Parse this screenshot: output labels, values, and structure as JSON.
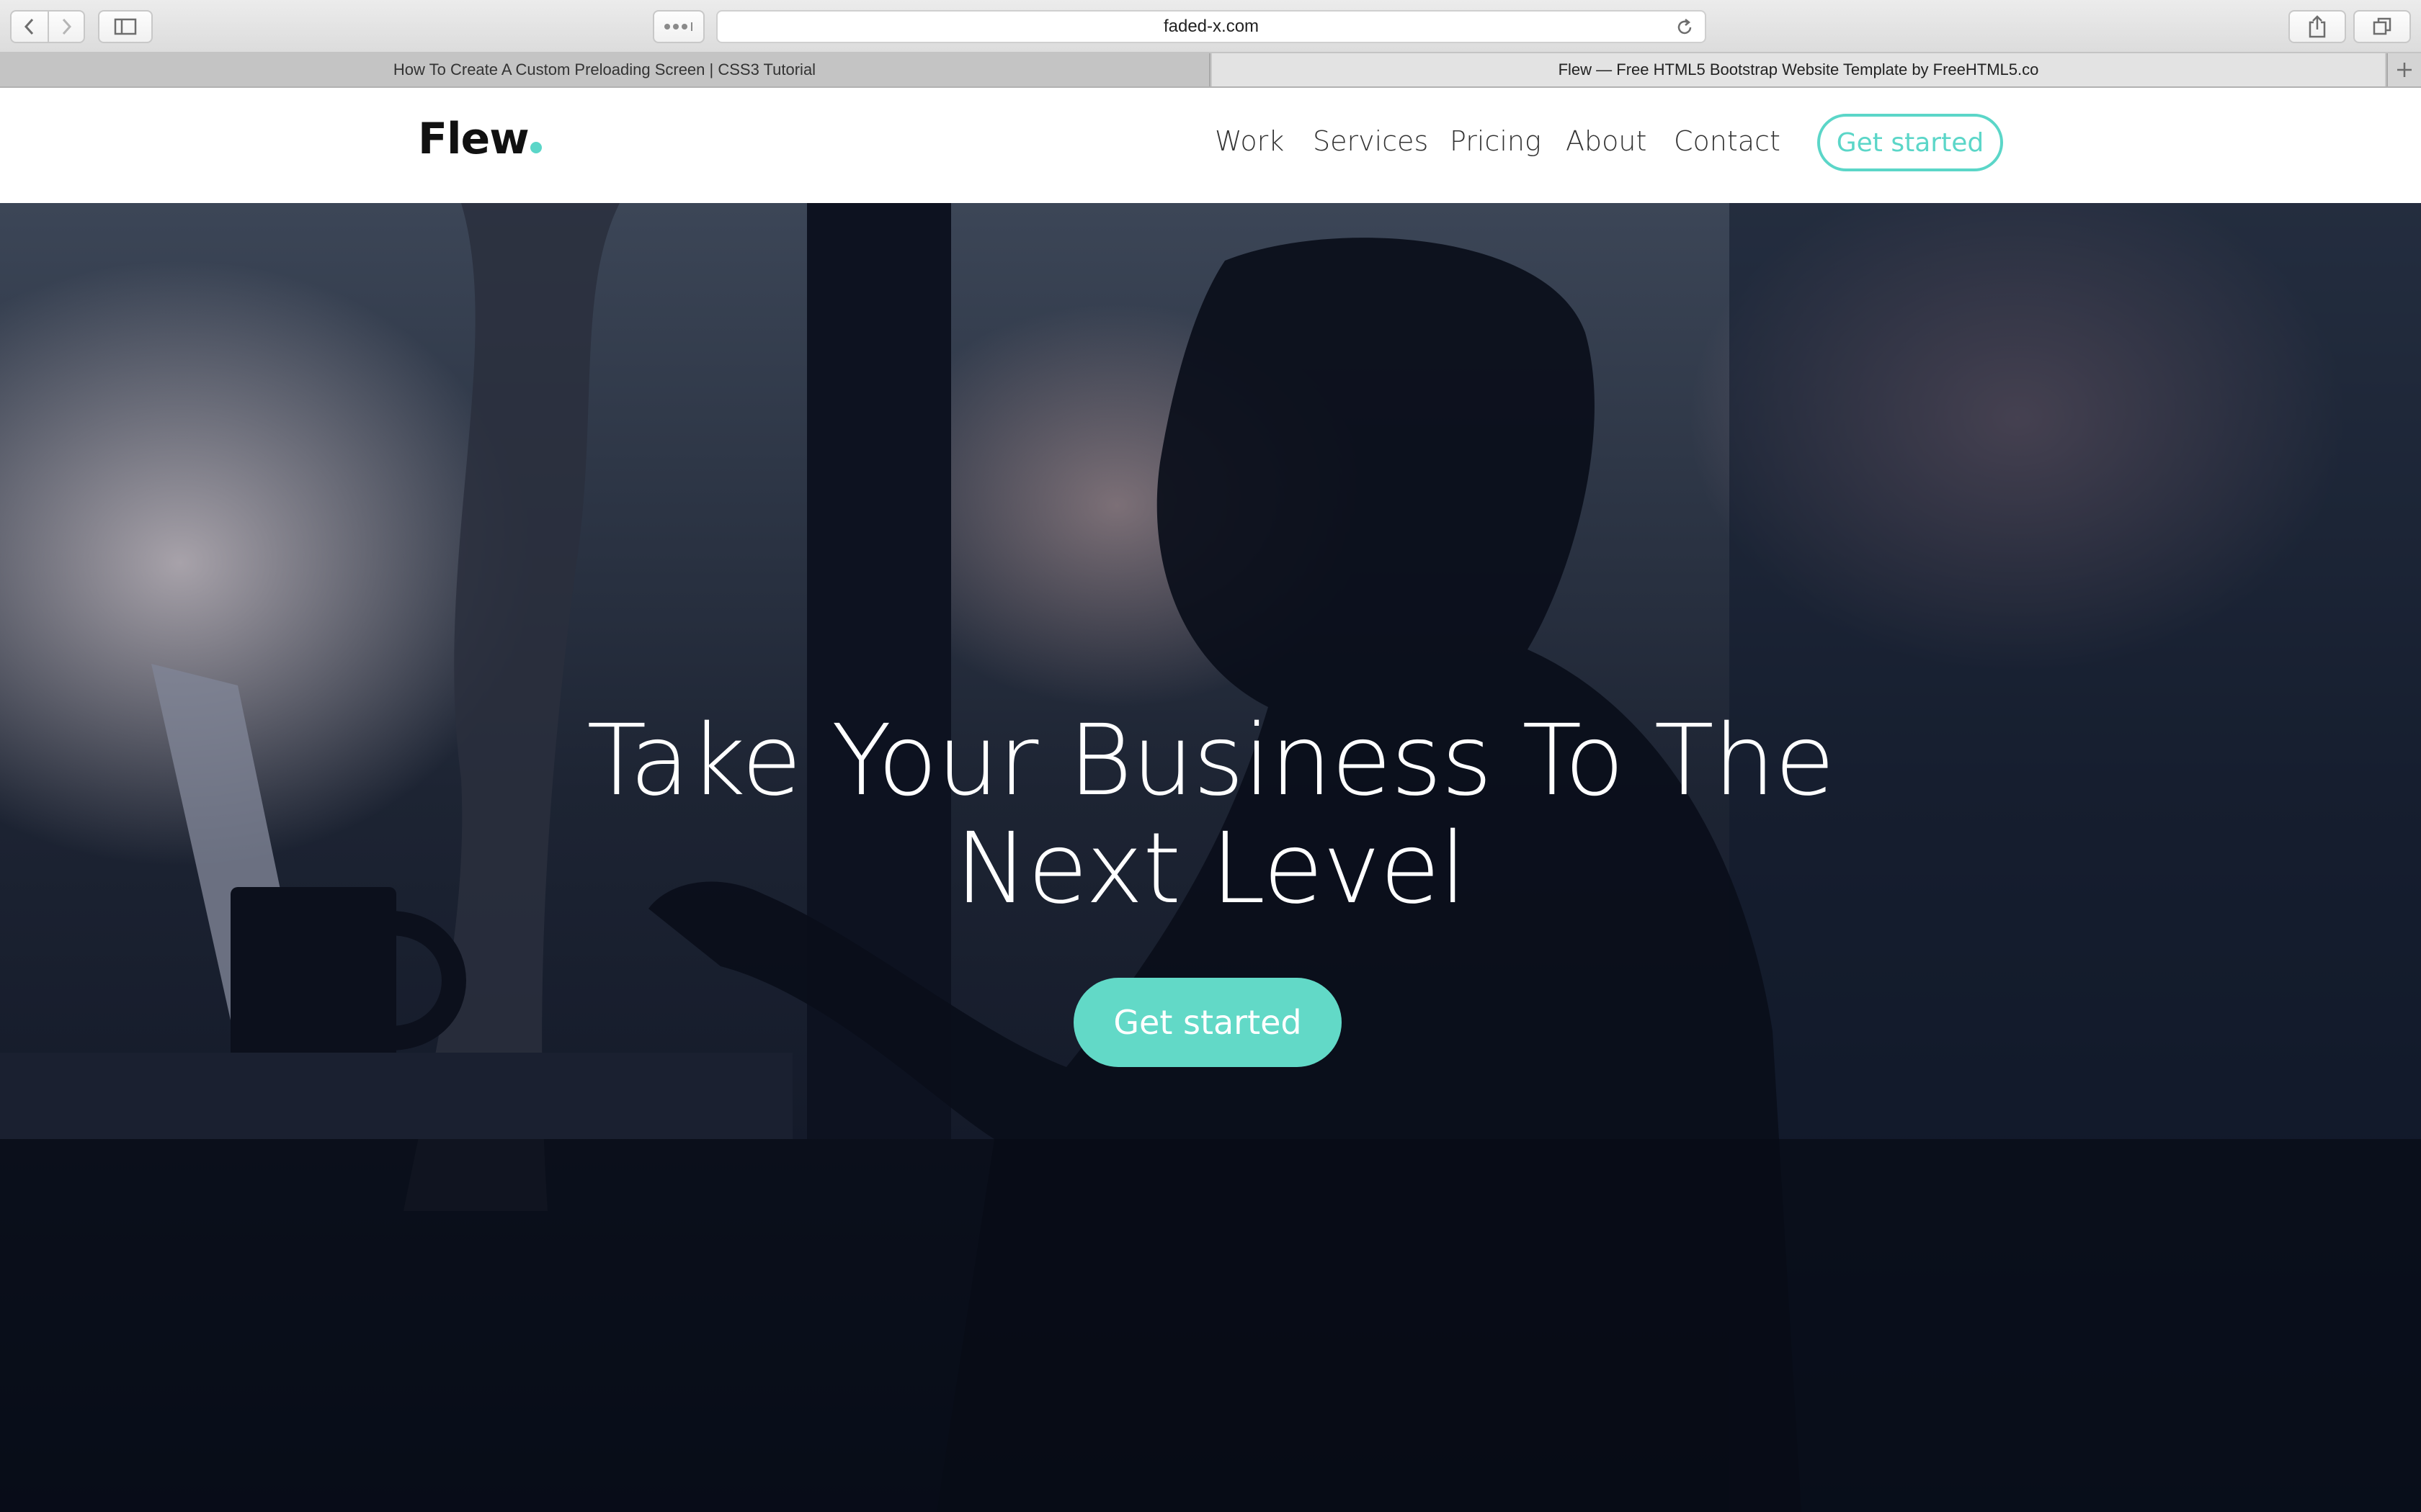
{
  "browser": {
    "url": "faded-x.com",
    "tabs": [
      {
        "title": "How To Create A Custom Preloading Screen | CSS3 Tutorial",
        "active": false
      },
      {
        "title": "Flew — Free HTML5 Bootstrap Website Template by FreeHTML5.co",
        "active": true
      }
    ],
    "icons": [
      "back-icon",
      "forward-icon",
      "sidebar-icon",
      "tab-overview-dots-icon",
      "reload-icon",
      "share-icon",
      "tabs-icon",
      "new-tab-plus-icon"
    ]
  },
  "site": {
    "logo": "Flew",
    "accent_color": "#5bd6c8",
    "nav": [
      "Work",
      "Services",
      "Pricing",
      "About",
      "Contact"
    ],
    "header_cta": "Get started"
  },
  "hero": {
    "title_line1": "Take Your Business To The",
    "title_line2": "Next Level",
    "cta": "Get started"
  }
}
